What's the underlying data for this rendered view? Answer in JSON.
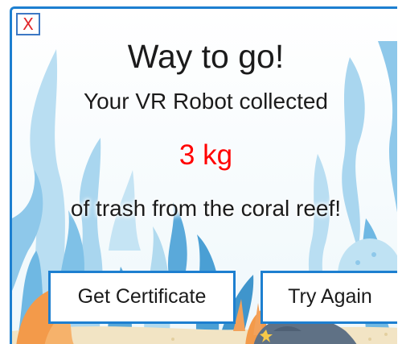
{
  "dialog": {
    "close_label": "X",
    "title": "Way to go!",
    "message_line1": "Your VR Robot collected",
    "amount": "3 kg",
    "message_line2": "of trash from the coral reef!",
    "buttons": {
      "certificate_label": "Get Certificate",
      "retry_label": "Try Again"
    }
  },
  "colors": {
    "frame": "#1d7fd0",
    "amount": "#ff0000",
    "close_glyph": "#e0262a",
    "seaweed_light": "#a9d6ef",
    "seaweed_mid": "#6fb8e3",
    "seaweed_dark": "#3f95cc",
    "coral_orange": "#f39a4a",
    "rock": "#5f7185",
    "sand": "#f2e4c4"
  },
  "icons": {
    "close": "close-icon",
    "background": "coral-reef-illustration"
  }
}
